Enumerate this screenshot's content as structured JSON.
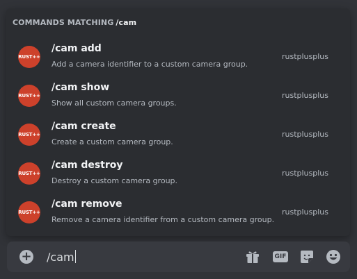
{
  "autocomplete": {
    "header_label": "COMMANDS MATCHING",
    "header_query": "/cam",
    "commands": [
      {
        "name": "/cam add",
        "description": "Add a camera identifier to a custom camera group.",
        "source": "rustplusplus",
        "avatar_text": "RUST++"
      },
      {
        "name": "/cam show",
        "description": "Show all custom camera groups.",
        "source": "rustplusplus",
        "avatar_text": "RUST++"
      },
      {
        "name": "/cam create",
        "description": "Create a custom camera group.",
        "source": "rustplusplus",
        "avatar_text": "RUST++"
      },
      {
        "name": "/cam destroy",
        "description": "Destroy a custom camera group.",
        "source": "rustplusplus",
        "avatar_text": "RUST++"
      },
      {
        "name": "/cam remove",
        "description": "Remove a camera identifier from a custom camera group.",
        "source": "rustplusplus",
        "avatar_text": "RUST++"
      }
    ]
  },
  "chat_input": {
    "value": "/cam",
    "add_icon": "plus-circle-icon",
    "gif_label": "GIF",
    "icons": [
      "gift-icon",
      "gif-icon",
      "sticker-icon",
      "emoji-icon"
    ]
  },
  "colors": {
    "background": "#313338",
    "popup": "#2b2d31",
    "input": "#383a40",
    "avatar": "#cd412b",
    "text_primary": "#f2f3f5",
    "text_muted": "#b5bac1"
  }
}
